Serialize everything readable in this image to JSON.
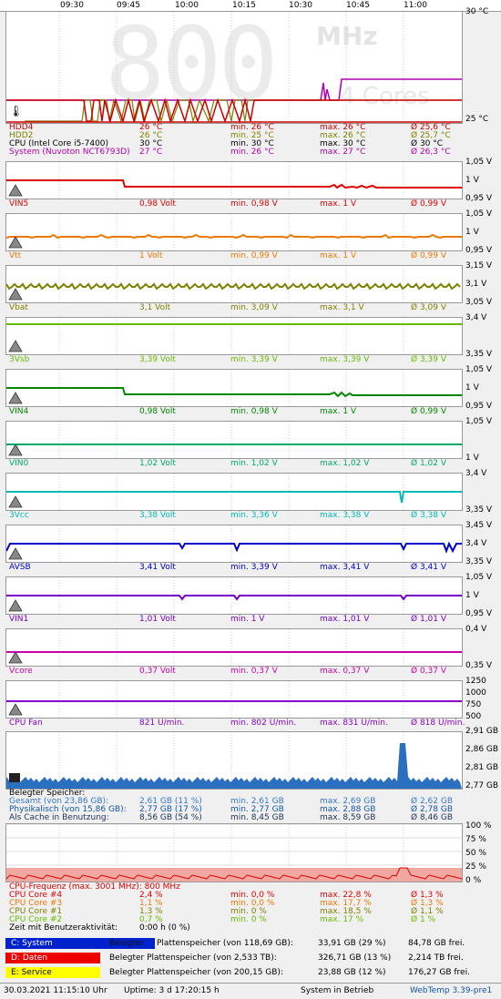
{
  "time_axis": [
    "09:30",
    "09:45",
    "10:00",
    "10:15",
    "10:30",
    "10:45",
    "11:00"
  ],
  "temp_panel": {
    "scale_top": "30 °C",
    "scale_bottom": "25 °C",
    "bg_freq": "800",
    "bg_unit": "MHz",
    "bg_cores": "4 Cores",
    "rows": [
      {
        "name": "HDD4",
        "cur": "26 °C",
        "min": "min. 26 °C",
        "max": "max. 26 °C",
        "avg": "Ø 25,6 °C",
        "color": "#cc0000"
      },
      {
        "name": "HDD2",
        "cur": "26 °C",
        "min": "min. 25 °C",
        "max": "max. 26 °C",
        "avg": "Ø 25,7 °C",
        "color": "#808000"
      },
      {
        "name": "CPU (Intel Core i5-7400)",
        "cur": "30 °C",
        "min": "min. 30 °C",
        "max": "max. 30 °C",
        "avg": "Ø 30 °C",
        "color": "#000000"
      },
      {
        "name": "System (Nuvoton NCT6793D)",
        "cur": "27 °C",
        "min": "min. 26 °C",
        "max": "max. 27 °C",
        "avg": "Ø 26,3 °C",
        "color": "#b000b0"
      }
    ]
  },
  "sensors": [
    {
      "name": "VIN5",
      "cur": "0,98 Volt",
      "min": "min. 0,98 V",
      "max": "max. 1 V",
      "avg": "Ø 0,99 V",
      "color": "#e00000",
      "scale": [
        "1,05 V",
        "1 V",
        "0,95 V"
      ],
      "pattern": "vin5"
    },
    {
      "name": "Vtt",
      "cur": "1 Volt",
      "min": "min. 0,99 V",
      "max": "max. 1 V",
      "avg": "Ø 0,99 V",
      "color": "#ee7700",
      "scale": [
        "1,05 V",
        "1 V",
        "0,95 V"
      ],
      "pattern": "vtt"
    },
    {
      "name": "Vbat",
      "cur": "3,1 Volt",
      "min": "min. 3,09 V",
      "max": "max. 3,1 V",
      "avg": "Ø 3,09 V",
      "color": "#808000",
      "scale": [
        "3,15 V",
        "3,1 V",
        "3,05 V"
      ],
      "pattern": "vbat"
    },
    {
      "name": "3Vsb",
      "cur": "3,39 Volt",
      "min": "min. 3,39 V",
      "max": "max. 3,39 V",
      "avg": "Ø 3,39 V",
      "color": "#66bb00",
      "scale": [
        "3,4 V",
        "",
        "3,35 V"
      ],
      "pattern": "flat_top"
    },
    {
      "name": "VIN4",
      "cur": "0,98 Volt",
      "min": "min. 0,98 V",
      "max": "max. 1 V",
      "avg": "Ø 0,99 V",
      "color": "#008800",
      "scale": [
        "1,05 V",
        "1 V",
        "0,95 V"
      ],
      "pattern": "vin4"
    },
    {
      "name": "VIN0",
      "cur": "1,02 Volt",
      "min": "min. 1,02 V",
      "max": "max. 1,02 V",
      "avg": "Ø 1,02 V",
      "color": "#00aa66",
      "scale": [
        "1,05 V",
        "",
        "1 V"
      ],
      "pattern": "flat_mid"
    },
    {
      "name": "3Vcc",
      "cur": "3,38 Volt",
      "min": "min. 3,36 V",
      "max": "max. 3,38 V",
      "avg": "Ø 3,38 V",
      "color": "#00bbbb",
      "scale": [
        "3,4 V",
        "",
        "3,35 V"
      ],
      "pattern": "v3vcc"
    },
    {
      "name": "AVSB",
      "cur": "3,41 Volt",
      "min": "min. 3,39 V",
      "max": "max. 3,41 V",
      "avg": "Ø 3,41 V",
      "color": "#0000cc",
      "scale": [
        "3,45 V",
        "3,4 V",
        "3,35 V"
      ],
      "pattern": "avsb"
    },
    {
      "name": "VIN1",
      "cur": "1,01 Volt",
      "min": "min. 1 V",
      "max": "max. 1,01 V",
      "avg": "Ø 1,01 V",
      "color": "#7700cc",
      "scale": [
        "1,05 V",
        "1 V",
        "0,95 V"
      ],
      "pattern": "vin1"
    },
    {
      "name": "Vcore",
      "cur": "0,37 Volt",
      "min": "min. 0,37 V",
      "max": "max. 0,37 V",
      "avg": "Ø 0,37 V",
      "color": "#cc00aa",
      "scale": [
        "0,4 V",
        "",
        "0,35 V"
      ],
      "pattern": "flat_mid"
    },
    {
      "name": "CPU Fan",
      "cur": "821 U/min.",
      "min": "min. 802 U/min.",
      "max": "max. 831 U/min.",
      "avg": "Ø 818 U/min.",
      "color": "#8800cc",
      "scale": [
        "1250",
        "1000",
        "750",
        "500"
      ],
      "pattern": "fan"
    }
  ],
  "memory": {
    "scale": [
      "2,91 GB",
      "2,86 GB",
      "2,81 GB",
      "2,77 GB"
    ],
    "title": "Belegter Speicher:",
    "rows": [
      {
        "name": "Gesamt (von 23,86 GB):",
        "cur": "2,61 GB (11 %)",
        "min": "min. 2,61 GB",
        "max": "max. 2,69 GB",
        "avg": "Ø 2,62 GB",
        "color": "#3377cc"
      },
      {
        "name": "Physikalisch (von 15,86 GB):",
        "cur": "2,77 GB (17 %)",
        "min": "min. 2,77 GB",
        "max": "max. 2,88 GB",
        "avg": "Ø 2,78 GB",
        "color": "#1155aa"
      },
      {
        "name": "Als Cache in Benutzung:",
        "cur": "8,56 GB (54 %)",
        "min": "min. 8,45 GB",
        "max": "max. 8,59 GB",
        "avg": "Ø 8,46 GB",
        "color": "#223355"
      }
    ]
  },
  "cpu": {
    "scale": [
      "100 %",
      "75 %",
      "50 %",
      "25 %",
      "0 %"
    ],
    "freq": "CPU-Frequenz (max. 3001 MHz): 800 MHz",
    "rows": [
      {
        "name": "CPU Core #4",
        "cur": "2,4 %",
        "min": "min. 0,0 %",
        "max": "max. 22,8 %",
        "avg": "Ø 1,3 %",
        "color": "#dd0000"
      },
      {
        "name": "CPU Core #3",
        "cur": "1,1 %",
        "min": "min. 0,0 %",
        "max": "max. 17,7 %",
        "avg": "Ø 1,3 %",
        "color": "#ee7700"
      },
      {
        "name": "CPU Core #1",
        "cur": "1,3 %",
        "min": "min. 0 %",
        "max": "max. 18,5 %",
        "avg": "Ø 1,1 %",
        "color": "#808000"
      },
      {
        "name": "CPU Core #2",
        "cur": "0,7 %",
        "min": "min. 0 %",
        "max": "max. 17 %",
        "avg": "Ø 1 %",
        "color": "#66bb00"
      }
    ],
    "idle_label": "Zeit mit Benutzeraktivität:",
    "idle_value": "0:00 h (0 %)"
  },
  "drives": [
    {
      "tag": "C: System",
      "label2": "Belegter",
      "desc": "Plattenspeicher (von 118,69 GB):",
      "used": "33,91 GB (29 %)",
      "free": "84,78 GB frei.",
      "fill": 0.29,
      "tag_color": "#0022cc",
      "text_color": "#ffffff"
    },
    {
      "tag": "D: Daten",
      "label2": "",
      "desc": "Belegter Plattenspeicher (von 2,533 TB):",
      "used": "326,71 GB (13 %)",
      "free": "2,214 TB frei.",
      "fill": 0.13,
      "tag_color": "#ee0000",
      "text_color": "#ffffff"
    },
    {
      "tag": "E: Service",
      "label2": "",
      "desc": "Belegter Plattenspeicher (von 200,15 GB):",
      "used": "23,88 GB (12 %)",
      "free": "176,27 GB frei.",
      "fill": 0.12,
      "tag_color": "#ffff00",
      "text_color": "#000000"
    }
  ],
  "status": {
    "datetime": "30.03.2021 11:15:10 Uhr",
    "uptime": "Uptime: 3 d 17:20:15 h",
    "state": "System in Betrieb",
    "version": "WebTemp 3.39-pre1"
  }
}
